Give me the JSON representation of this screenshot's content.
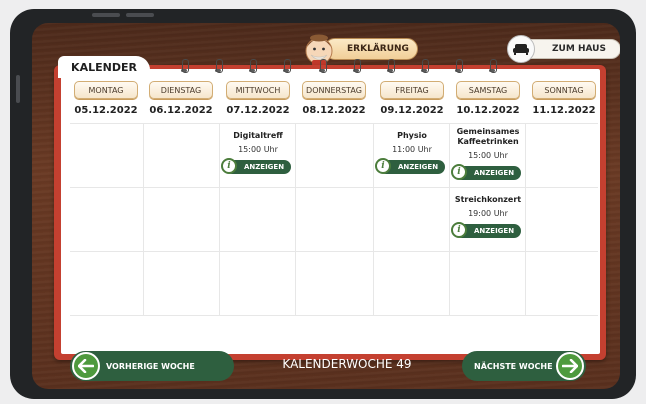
{
  "header": {
    "explain_label": "ERKLÄRUNG",
    "home_label": "ZUM HAUS"
  },
  "calendar": {
    "tab_label": "KALENDER",
    "days": [
      {
        "name": "MONTAG",
        "date": "05.12.2022"
      },
      {
        "name": "DIENSTAG",
        "date": "06.12.2022"
      },
      {
        "name": "MITTWOCH",
        "date": "07.12.2022"
      },
      {
        "name": "DONNERSTAG",
        "date": "08.12.2022"
      },
      {
        "name": "FREITAG",
        "date": "09.12.2022"
      },
      {
        "name": "SAMSTAG",
        "date": "10.12.2022"
      },
      {
        "name": "SONNTAG",
        "date": "11.12.2022"
      }
    ],
    "events": [
      {
        "day": "MITTWOCH",
        "title": "Digitaltreff",
        "time": "15:00 Uhr",
        "button": "ANZEIGEN"
      },
      {
        "day": "FREITAG",
        "title": "Physio",
        "time": "11:00 Uhr",
        "button": "ANZEIGEN"
      },
      {
        "day": "SAMSTAG",
        "title": "Gemeinsames Kaffeetrinken",
        "time": "15:00 Uhr",
        "button": "ANZEIGEN"
      },
      {
        "day": "SAMSTAG",
        "title": "Streichkonzert",
        "time": "19:00 Uhr",
        "button": "ANZEIGEN"
      }
    ]
  },
  "footer": {
    "prev_label": "VORHERIGE WOCHE",
    "week_label": "KALENDERWOCHE 49",
    "next_label": "NÄCHSTE WOCHE"
  },
  "colors": {
    "wood": "#5a301e",
    "board_red": "#c44030",
    "button_green": "#2e5f3f",
    "arrow_green": "#4e9a3e",
    "chip_border": "#d2ad74"
  },
  "icons": {
    "avatar": "grandfather-avatar-icon",
    "home": "sofa-icon",
    "info": "info-icon",
    "prev": "arrow-left-icon",
    "next": "arrow-right-icon"
  }
}
